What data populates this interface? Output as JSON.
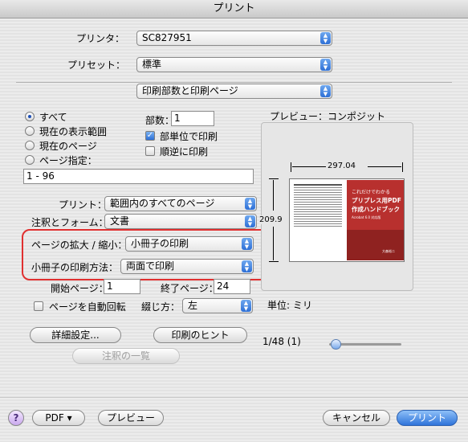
{
  "window": {
    "title": "プリント"
  },
  "printer": {
    "label": "プリンタ：",
    "value": "SC827951"
  },
  "preset": {
    "label": "プリセット：",
    "value": "標準"
  },
  "panel": {
    "value": "印刷部数と印刷ページ"
  },
  "pages": {
    "all": "すべて",
    "current_range": "現在の表示範囲",
    "current_page": "現在のページ",
    "specified": "ページ指定：",
    "range_value": "1 - 96",
    "selected": "all"
  },
  "copies": {
    "label": "部数：",
    "value": "1",
    "collate": "部単位で印刷",
    "collate_checked": true,
    "reverse": "順逆に印刷",
    "reverse_checked": false
  },
  "print_popup": {
    "label": "プリント：",
    "value": "範囲内のすべてのページ"
  },
  "annot_popup": {
    "label": "注釈とフォーム：",
    "value": "文書"
  },
  "scale_popup": {
    "label": "ページの拡大 / 縮小：",
    "value": "小冊子の印刷"
  },
  "booklet_popup": {
    "label": "小冊子の印刷方法：",
    "value": "両面で印刷"
  },
  "start_page": {
    "label": "開始ページ：",
    "value": "1"
  },
  "end_page": {
    "label": "終了ページ：",
    "value": "24"
  },
  "auto_rotate": {
    "label": "ページを自動回転",
    "checked": false
  },
  "binding": {
    "label": "綴じ方：",
    "value": "左"
  },
  "buttons": {
    "advanced": "詳細設定...",
    "print_tips": "印刷のヒント",
    "annot_list": "注釈の一覧",
    "help": "?",
    "pdf": "PDF ▾",
    "preview": "プレビュー",
    "cancel": "キャンセル",
    "print": "プリント"
  },
  "preview": {
    "title": "プレビュー：コンポジット",
    "width": "297.04",
    "height": "209.9",
    "unit": "単位: ミリ",
    "page_counter": "1/48 (1)",
    "slider_fraction": 0.02,
    "cover_lines": [
      "これだけでわかる",
      "プリプレス用PDF",
      "作成ハンドブック"
    ],
    "cover_sub": "Acrobat 6.0 対応版",
    "cover_author": "大森裕二"
  },
  "colors": {
    "accent": "#2d6fd6",
    "highlight_box": "#e03030",
    "cover": "#b8302e"
  }
}
